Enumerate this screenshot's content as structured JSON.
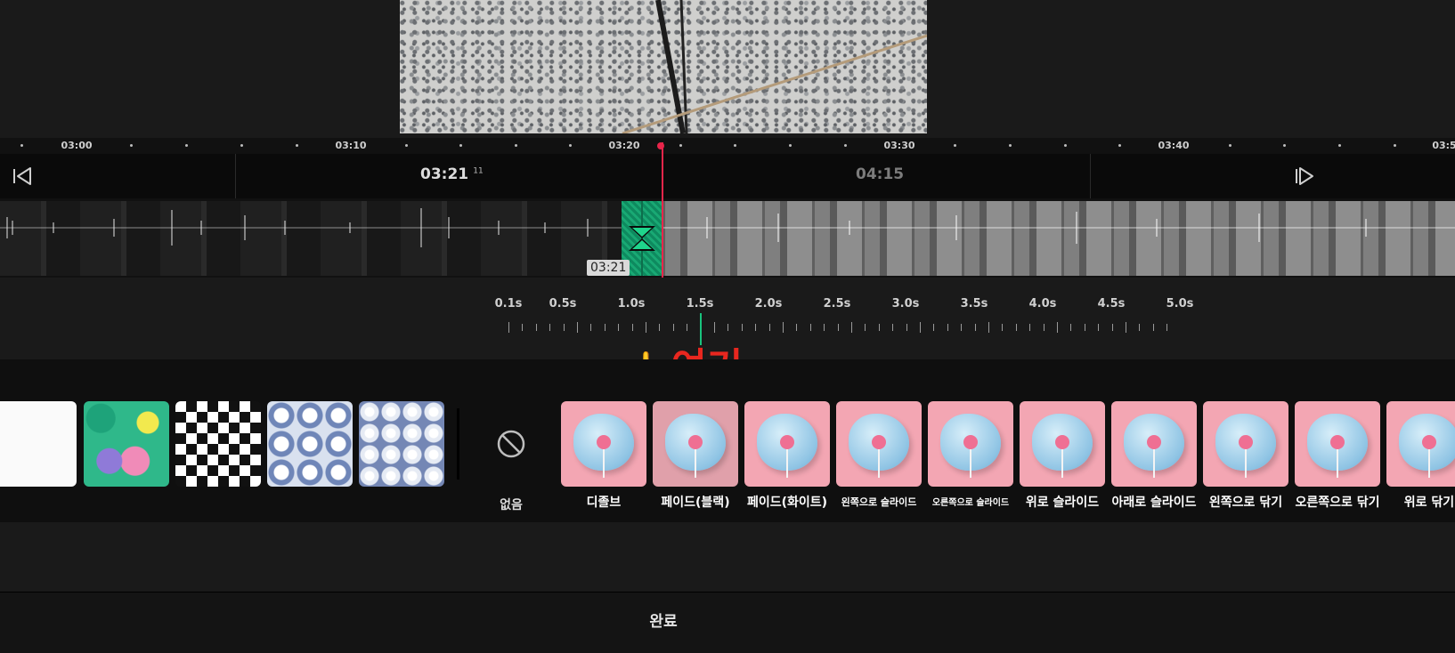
{
  "ruler": {
    "labels": [
      "03:00",
      "03:10",
      "03:20",
      "03:30",
      "03:40",
      "03:5"
    ]
  },
  "controls": {
    "current_time": "03:21",
    "current_frame": "11",
    "total_time": "04:15"
  },
  "clip": {
    "time_badge": "03:21"
  },
  "duration": {
    "labels": [
      "0.1s",
      "0.5s",
      "1.0s",
      "1.5s",
      "2.0s",
      "2.5s",
      "3.0s",
      "3.5s",
      "4.0s",
      "4.5s",
      "5.0s"
    ],
    "selected": "1.5s"
  },
  "annotation": {
    "text": "여기",
    "icon": "pointing-hand-icon"
  },
  "effects": {
    "none_label": "없음",
    "items": [
      {
        "label": "디졸브"
      },
      {
        "label": "페이드(블랙)"
      },
      {
        "label": "페이드(화이트)"
      },
      {
        "label": "왼쪽으로 슬라이드"
      },
      {
        "label": "오른쪽으로 슬라이드"
      },
      {
        "label": "위로 슬라이드"
      },
      {
        "label": "아래로 슬라이드"
      },
      {
        "label": "왼쪽으로 닦기"
      },
      {
        "label": "오른쪽으로 닦기"
      },
      {
        "label": "위로 닦기"
      }
    ]
  },
  "footer": {
    "done_label": "완료"
  },
  "colors": {
    "playhead": "#e8254a",
    "transition": "#19a974",
    "annotation": "#e8271f"
  }
}
